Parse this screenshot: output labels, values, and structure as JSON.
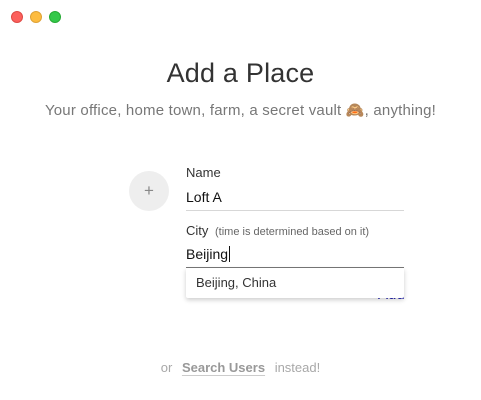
{
  "window": {
    "controls": [
      "close",
      "minimize",
      "zoom"
    ]
  },
  "header": {
    "title": "Add a Place",
    "subtitle": "Your office, home town, farm, a secret vault 🙈, anything!"
  },
  "form": {
    "avatar_icon": "+",
    "name": {
      "label": "Name",
      "value": "Loft A"
    },
    "city": {
      "label": "City",
      "hint": "(time is determined based on it)",
      "value": "Beijing"
    },
    "add_label": "Add",
    "suggestions": [
      "Beijing, China"
    ]
  },
  "footer": {
    "prefix": "or",
    "link": "Search Users",
    "suffix": "instead!"
  }
}
